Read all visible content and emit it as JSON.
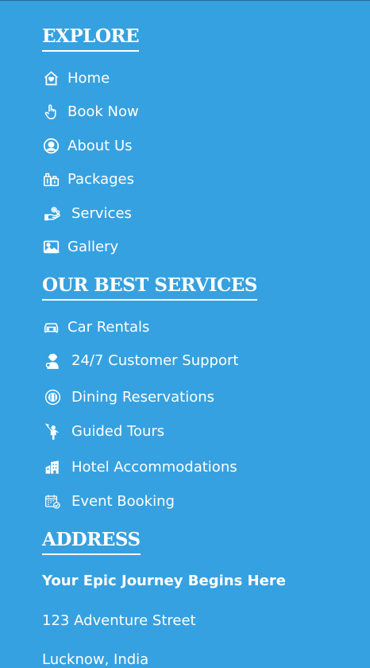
{
  "explore": {
    "heading": "EXPLORE",
    "items": [
      {
        "label": "Home",
        "icon": "home-icon"
      },
      {
        "label": "Book Now",
        "icon": "hand-pointer-icon"
      },
      {
        "label": "About Us",
        "icon": "user-circle-icon"
      },
      {
        "label": "Packages",
        "icon": "luggage-icon"
      },
      {
        "label": "Services",
        "icon": "service-hand-icon"
      },
      {
        "label": "Gallery",
        "icon": "image-icon"
      }
    ]
  },
  "services": {
    "heading": "OUR BEST SERVICES",
    "items": [
      {
        "label": "Car Rentals",
        "icon": "car-icon"
      },
      {
        "label": "24/7 Customer Support",
        "icon": "support-agent-icon"
      },
      {
        "label": "Dining Reservations",
        "icon": "dining-icon"
      },
      {
        "label": "Guided Tours",
        "icon": "tour-guide-icon"
      },
      {
        "label": "Hotel Accommodations",
        "icon": "hotel-building-icon"
      },
      {
        "label": "Event Booking",
        "icon": "calendar-check-icon"
      }
    ]
  },
  "address": {
    "heading": "ADDRESS",
    "tagline": "Your Epic Journey Begins Here",
    "street": "123 Adventure Street",
    "city": "Lucknow, India"
  },
  "colors": {
    "background": "#36a1e0",
    "text": "#ffffff"
  }
}
